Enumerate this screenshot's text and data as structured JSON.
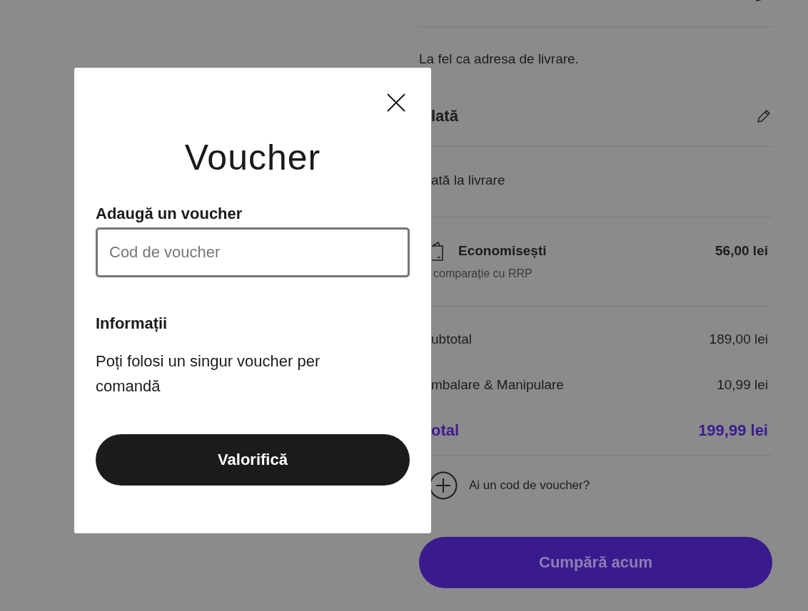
{
  "background_page": {
    "billing_note": "La fel ca adresa de livrare.",
    "payment": {
      "heading": "lată",
      "method": "ată la livrare"
    },
    "savings": {
      "label": "Economisești",
      "amount": "56,00 lei",
      "note": "comparație cu RRP"
    },
    "summary": [
      {
        "kind": "line",
        "label": "ubtotal",
        "value": "189,00 lei"
      },
      {
        "kind": "line",
        "label": "mbalare & Manipulare",
        "value": "10,99 lei"
      },
      {
        "kind": "total",
        "label": "otal",
        "value": "199,99 lei"
      }
    ],
    "voucher_link": "Ai un cod de voucher?",
    "buy_button": "Cumpără acum"
  },
  "modal": {
    "title": "Voucher",
    "field_label": "Adaugă un voucher",
    "placeholder": "Cod de voucher",
    "info_heading": "Informații",
    "info_text": "Poți folosi un singur voucher per comandă",
    "submit_button": "Valorifică"
  }
}
